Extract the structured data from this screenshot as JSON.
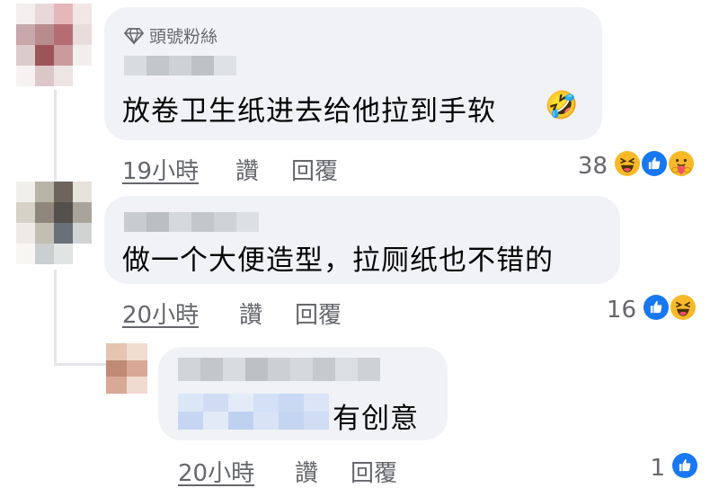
{
  "comments": [
    {
      "badge": "頭號粉絲",
      "text": "放卷卫生纸进去给他拉到手软",
      "emoji": "🤣",
      "time": "19小時",
      "like_label": "讚",
      "reply_label": "回覆",
      "reaction_count": "38",
      "reactions": [
        "haha-reaction-icon",
        "like-reaction-icon",
        "care-reaction-icon"
      ]
    },
    {
      "text": "做一个大便造型，拉厕纸也不错的",
      "time": "20小時",
      "like_label": "讚",
      "reply_label": "回覆",
      "reaction_count": "16",
      "reactions": [
        "like-reaction-icon",
        "haha-reaction-icon"
      ]
    },
    {
      "text": "有创意",
      "time": "20小時",
      "like_label": "讚",
      "reply_label": "回覆",
      "reaction_count": "1",
      "reactions": [
        "like-reaction-icon"
      ]
    }
  ],
  "colors": {
    "bubble": "#f0f2f5",
    "meta_text": "#65676b",
    "like_blue": "#1877f2",
    "haha_yellow": "#f7b928"
  }
}
